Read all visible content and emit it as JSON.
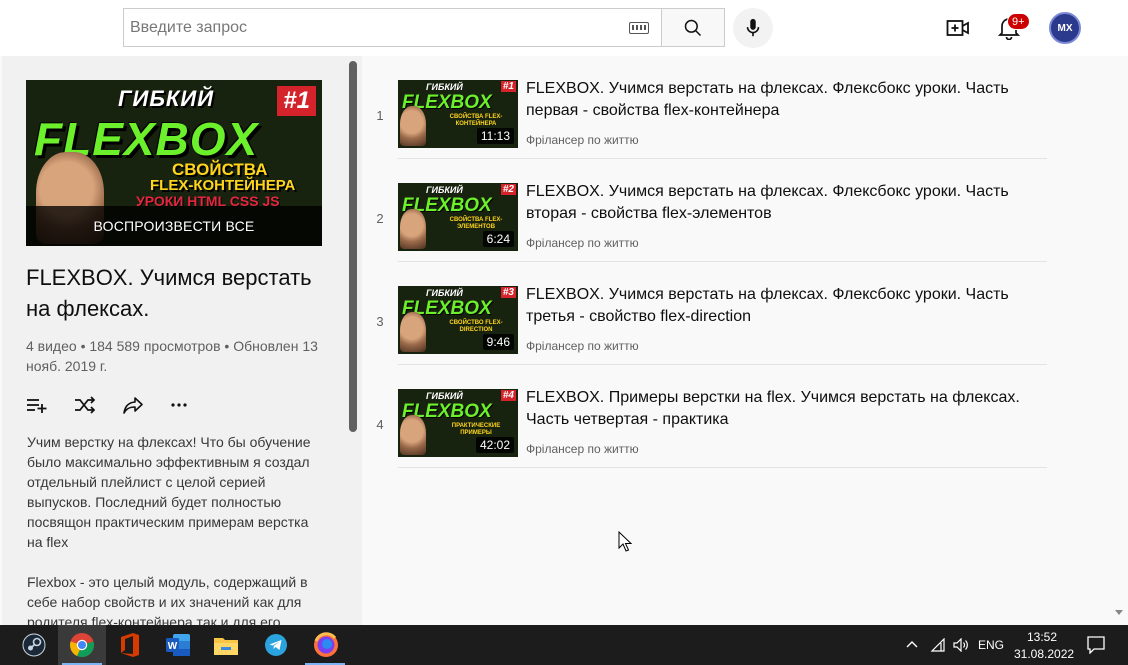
{
  "search": {
    "placeholder": "Введите запрос"
  },
  "header": {
    "notification_count": "9+",
    "avatar_initials": "MX"
  },
  "playlist": {
    "thumbnail": {
      "top_text": "ГИБКИЙ",
      "number": "#1",
      "main_text": "FLEXBOX",
      "sub_line_1": "СВОЙСТВА",
      "sub_line_2": "FLEX-КОНТЕЙНЕРА",
      "sub_line_3": "УРОКИ HTML CSS JS"
    },
    "play_all_label": "ВОСПРОИЗВЕСТИ ВСЕ",
    "title": "FLEXBOX. Учимся верстать на флексах.",
    "stats": "4 видео • 184 589 просмотров • Обновлен 13 нояб. 2019 г.",
    "description": [
      "Учим верстку на флексах! Что бы обучение было максимально эффективным я создал отдельный плейлист с целой серией выпусков. Последний будет полностью посвящон практическим примерам верстка на flex",
      "Flexbox - это целый модуль, содержащий в себе набор свойств и их значений как для родителя flex-контейнера так и для его"
    ]
  },
  "videos": [
    {
      "index": "1",
      "title": "FLEXBOX. Учимся верстать на флексах. Флексбокс уроки. Часть первая - свойства flex-контейнера",
      "channel": "Фрілансер по життю",
      "duration": "11:13",
      "thumb_num": "#1",
      "thumb_top": "ГИБКИЙ",
      "thumb_main": "FLEXBOX",
      "thumb_sub": "СВОЙСТВА FLEX-КОНТЕЙНЕРА"
    },
    {
      "index": "2",
      "title": "FLEXBOX. Учимся верстать на флексах. Флексбокс уроки. Часть вторая - свойства flex-элементов",
      "channel": "Фрілансер по життю",
      "duration": "6:24",
      "thumb_num": "#2",
      "thumb_top": "ГИБКИЙ",
      "thumb_main": "FLEXBOX",
      "thumb_sub": "СВОЙСТВА FLEX-ЭЛЕМЕНТОВ"
    },
    {
      "index": "3",
      "title": "FLEXBOX. Учимся верстать на флексах. Флексбокс уроки. Часть третья - свойство flex-direction",
      "channel": "Фрілансер по життю",
      "duration": "9:46",
      "thumb_num": "#3",
      "thumb_top": "ГИБКИЙ",
      "thumb_main": "FLEXBOX",
      "thumb_sub": "СВОЙСТВО FLEX-DIRECTION"
    },
    {
      "index": "4",
      "title": "FLEXBOX. Примеры верстки на flex. Учимся верстать на флексах. Часть четвертая - практика",
      "channel": "Фрілансер по життю",
      "duration": "42:02",
      "thumb_num": "#4",
      "thumb_top": "ГИБКИЙ",
      "thumb_main": "FLEXBOX",
      "thumb_sub": "ПРАКТИЧЕСКИЕ ПРИМЕРЫ"
    }
  ],
  "taskbar": {
    "apps": [
      "steam-icon",
      "chrome-icon",
      "office-icon",
      "word-icon",
      "file-explorer-icon",
      "telegram-icon",
      "firefox-icon"
    ],
    "language": "ENG",
    "time": "13:52",
    "date": "31.08.2022"
  }
}
